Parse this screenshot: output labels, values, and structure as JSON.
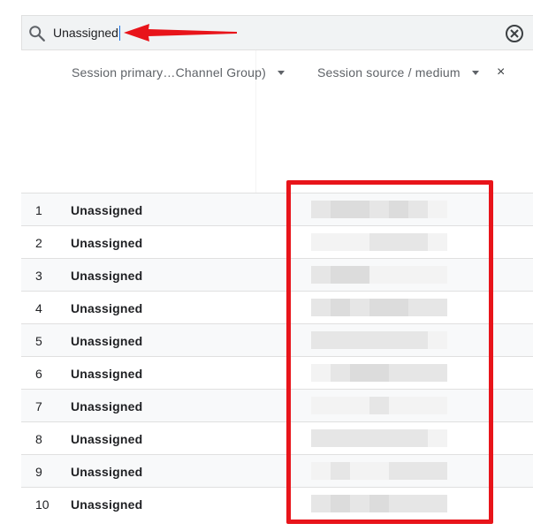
{
  "search": {
    "value": "Unassigned"
  },
  "columns": {
    "primary": "Session primary…Channel Group)",
    "secondary": "Session source / medium",
    "remove_symbol": "×"
  },
  "rows": [
    {
      "index": "1",
      "value": "Unassigned"
    },
    {
      "index": "2",
      "value": "Unassigned"
    },
    {
      "index": "3",
      "value": "Unassigned"
    },
    {
      "index": "4",
      "value": "Unassigned"
    },
    {
      "index": "5",
      "value": "Unassigned"
    },
    {
      "index": "6",
      "value": "Unassigned"
    },
    {
      "index": "7",
      "value": "Unassigned"
    },
    {
      "index": "8",
      "value": "Unassigned"
    },
    {
      "index": "9",
      "value": "Unassigned"
    },
    {
      "index": "10",
      "value": "Unassigned"
    }
  ],
  "colors": {
    "annotation_red": "#e8141a",
    "blur_gray": "#e3e3e3",
    "cursor_blue": "#1a73e8"
  },
  "icons": {
    "search": "search-icon",
    "clear": "clear-circle-icon",
    "dropdown": "caret-down-icon",
    "annotation": "red-arrow-annotation"
  }
}
